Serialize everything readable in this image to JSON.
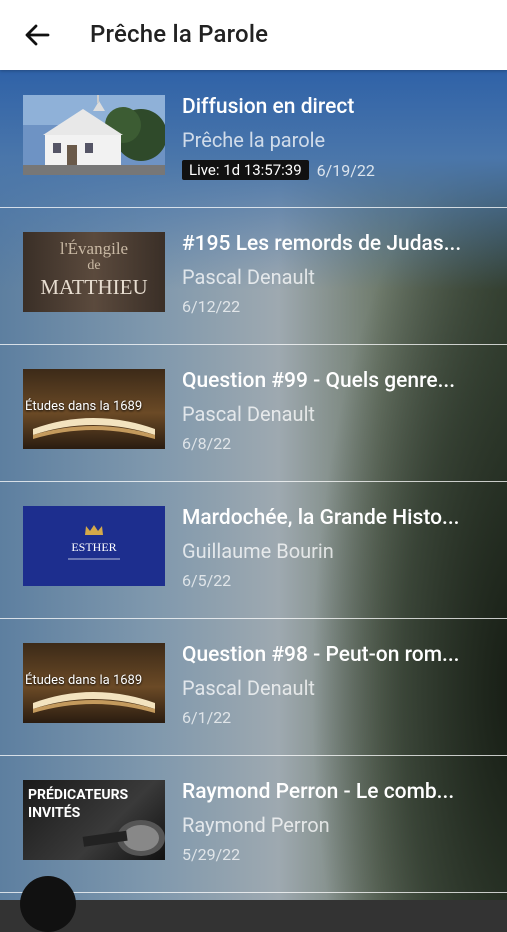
{
  "header": {
    "title": "Prêche la Parole"
  },
  "items": [
    {
      "title": "Diffusion en direct",
      "subtitle": "Prêche la parole",
      "live": "Live: 1d 13:57:39",
      "date": "6/19/22",
      "thumb": "church-building"
    },
    {
      "title": "#195 Les remords de Judas...",
      "subtitle": "Pascal Denault",
      "date": "6/12/22",
      "thumb_line1": "l'Évangile",
      "thumb_line2": "de",
      "thumb_line3": "MATTHIEU"
    },
    {
      "title": "Question #99 - Quels genre...",
      "subtitle": "Pascal Denault",
      "date": "6/8/22",
      "thumb_label": "Études dans la 1689"
    },
    {
      "title": "Mardochée, la Grande Histo...",
      "subtitle": "Guillaume Bourin",
      "date": "6/5/22",
      "thumb_label": "ESTHER"
    },
    {
      "title": "Question #98 - Peut-on rom...",
      "subtitle": "Pascal Denault",
      "date": "6/1/22",
      "thumb_label": "Études dans la 1689"
    },
    {
      "title": "Raymond Perron - Le comb...",
      "subtitle": "Raymond Perron",
      "date": "5/29/22",
      "thumb_line1": "PRÉDICATEURS",
      "thumb_line2": "INVITÉS"
    }
  ]
}
